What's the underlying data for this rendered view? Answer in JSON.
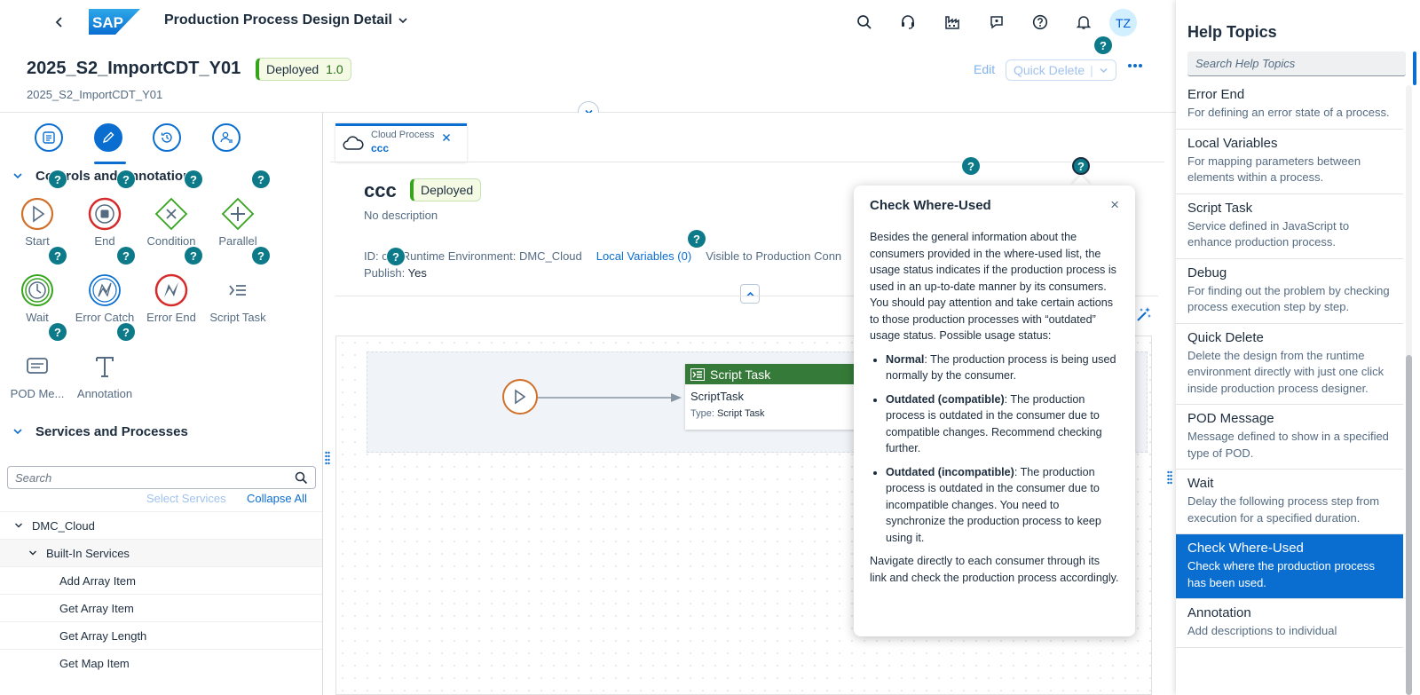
{
  "shell": {
    "logo_text": "SAP",
    "app_title": "Production Process Design Detail",
    "avatar_initials": "TZ",
    "icons": [
      "search-icon",
      "headset-icon",
      "factory-icon",
      "feedback-icon",
      "help-icon",
      "bell-icon"
    ]
  },
  "header": {
    "title": "2025_S2_ImportCDT_Y01",
    "status": "Deployed",
    "version": "1.0",
    "subtitle": "2025_S2_ImportCDT_Y01",
    "edit_label": "Edit",
    "quick_delete_label": "Quick Delete",
    "quick_delete_sep": "|"
  },
  "left": {
    "controls_title": "Controls and Annotations",
    "controls": [
      {
        "label": "Start"
      },
      {
        "label": "End"
      },
      {
        "label": "Condition"
      },
      {
        "label": "Parallel"
      },
      {
        "label": "Wait"
      },
      {
        "label": "Error Catch"
      },
      {
        "label": "Error End"
      },
      {
        "label": "Script Task"
      },
      {
        "label": "POD Me..."
      },
      {
        "label": "Annotation"
      }
    ],
    "services_title": "Services and Processes",
    "search_placeholder": "Search",
    "select_services": "Select Services",
    "collapse_all": "Collapse All",
    "tree": [
      {
        "label": "DMC_Cloud"
      },
      {
        "label": "Built-In Services"
      },
      {
        "label": "Add Array Item"
      },
      {
        "label": "Get Array Item"
      },
      {
        "label": "Get Array Length"
      },
      {
        "label": "Get Map Item"
      }
    ]
  },
  "center": {
    "tab_type": "Cloud Process",
    "tab_name": "ccc",
    "process_name": "ccc",
    "process_status": "Deployed",
    "description": "No description",
    "id_label": "ID: c",
    "runtime": "Runtime Environment: DMC_Cloud",
    "local_vars": "Local Variables (0)",
    "visible": "Visible to Production Conn",
    "publish_label": "Publish:",
    "publish_value": "Yes",
    "task_header": "Script Task",
    "task_name": "ScriptTask",
    "task_type_label": "Type:",
    "task_type_value": "Script Task"
  },
  "popover": {
    "title": "Check Where-Used",
    "close": "×",
    "intro": "Besides the general information about the consumers provided in the where-used list, the usage status indicates if the production process is used in an up-to-date manner by its consumers. You should pay attention and take certain actions to those production processes with “outdated” usage status. Possible usage status:",
    "items": [
      {
        "term": "Normal",
        "text": ": The production process is being used normally by the consumer."
      },
      {
        "term": "Outdated (compatible)",
        "text": ": The production process is outdated in the consumer due to compatible changes. Recommend checking further."
      },
      {
        "term": "Outdated (incompatible)",
        "text": ": The production process is outdated in the consumer due to incompatible changes. You need to synchronize the production process to keep using it."
      }
    ],
    "outro": "Navigate directly to each consumer through its link and check the production process accordingly."
  },
  "help": {
    "title": "Help Topics",
    "search_placeholder": "Search Help Topics",
    "topics": [
      {
        "title": "Error End",
        "desc": "For defining an error state of a process."
      },
      {
        "title": "Local Variables",
        "desc": "For mapping parameters between elements within a process."
      },
      {
        "title": "Script Task",
        "desc": "Service defined in JavaScript to enhance production process."
      },
      {
        "title": "Debug",
        "desc": "For finding out the problem by checking process execution step by step."
      },
      {
        "title": "Quick Delete",
        "desc": "Delete the design from the runtime environment directly with just one click inside production process designer."
      },
      {
        "title": "POD Message",
        "desc": "Message defined to show in a specified type of POD."
      },
      {
        "title": "Wait",
        "desc": "Delay the following process step from execution for a specified duration."
      },
      {
        "title": "Check Where-Used",
        "desc": "Check where the production process has been used.",
        "selected": true
      },
      {
        "title": "Annotation",
        "desc": "Add descriptions to individual"
      }
    ]
  },
  "help_bubble": "?",
  "colors": {
    "accent": "#0a6ed1",
    "deployed": "#36a41d",
    "help_bubble": "#0d7a8a",
    "script_task": "#357a38",
    "start_event": "#d0702a",
    "end_event": "#d62b2b"
  }
}
